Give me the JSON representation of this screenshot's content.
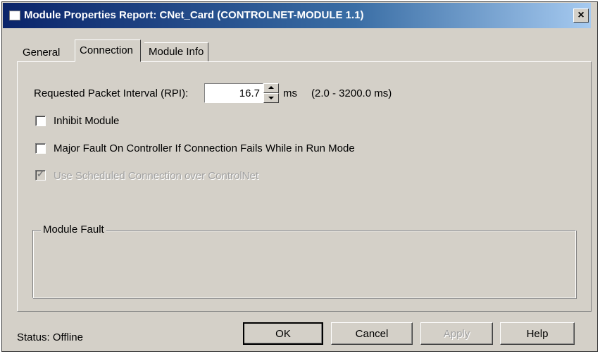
{
  "window": {
    "title": "Module Properties Report: CNet_Card (CONTROLNET-MODULE 1.1)",
    "close_glyph": "×"
  },
  "tabs": [
    {
      "label": "General",
      "selected": false
    },
    {
      "label": "Connection",
      "selected": true
    },
    {
      "label": "Module Info",
      "selected": false
    }
  ],
  "connection": {
    "rpi_label": "Requested Packet Interval (RPI):",
    "rpi_value": "16.7",
    "rpi_unit": "ms",
    "rpi_range": "(2.0 - 3200.0 ms)",
    "inhibit_label": "Inhibit Module",
    "inhibit_checked": false,
    "major_fault_label": "Major Fault On Controller If Connection Fails While in Run Mode",
    "major_fault_checked": false,
    "scheduled_label": "Use Scheduled Connection over ControlNet",
    "scheduled_checked": true,
    "scheduled_enabled": false
  },
  "module_fault": {
    "label": "Module Fault"
  },
  "footer": {
    "status": "Status:  Offline",
    "ok_label": "OK",
    "cancel_label": "Cancel",
    "apply_label": "Apply",
    "help_label": "Help"
  },
  "colors": {
    "face": "#d4d0c8",
    "title_start": "#0a246a",
    "title_end": "#a6caf0",
    "disabled_text": "#a0a0a0"
  },
  "icons": [
    "window-icon",
    "close-icon",
    "spin-up-icon",
    "spin-down-icon"
  ]
}
